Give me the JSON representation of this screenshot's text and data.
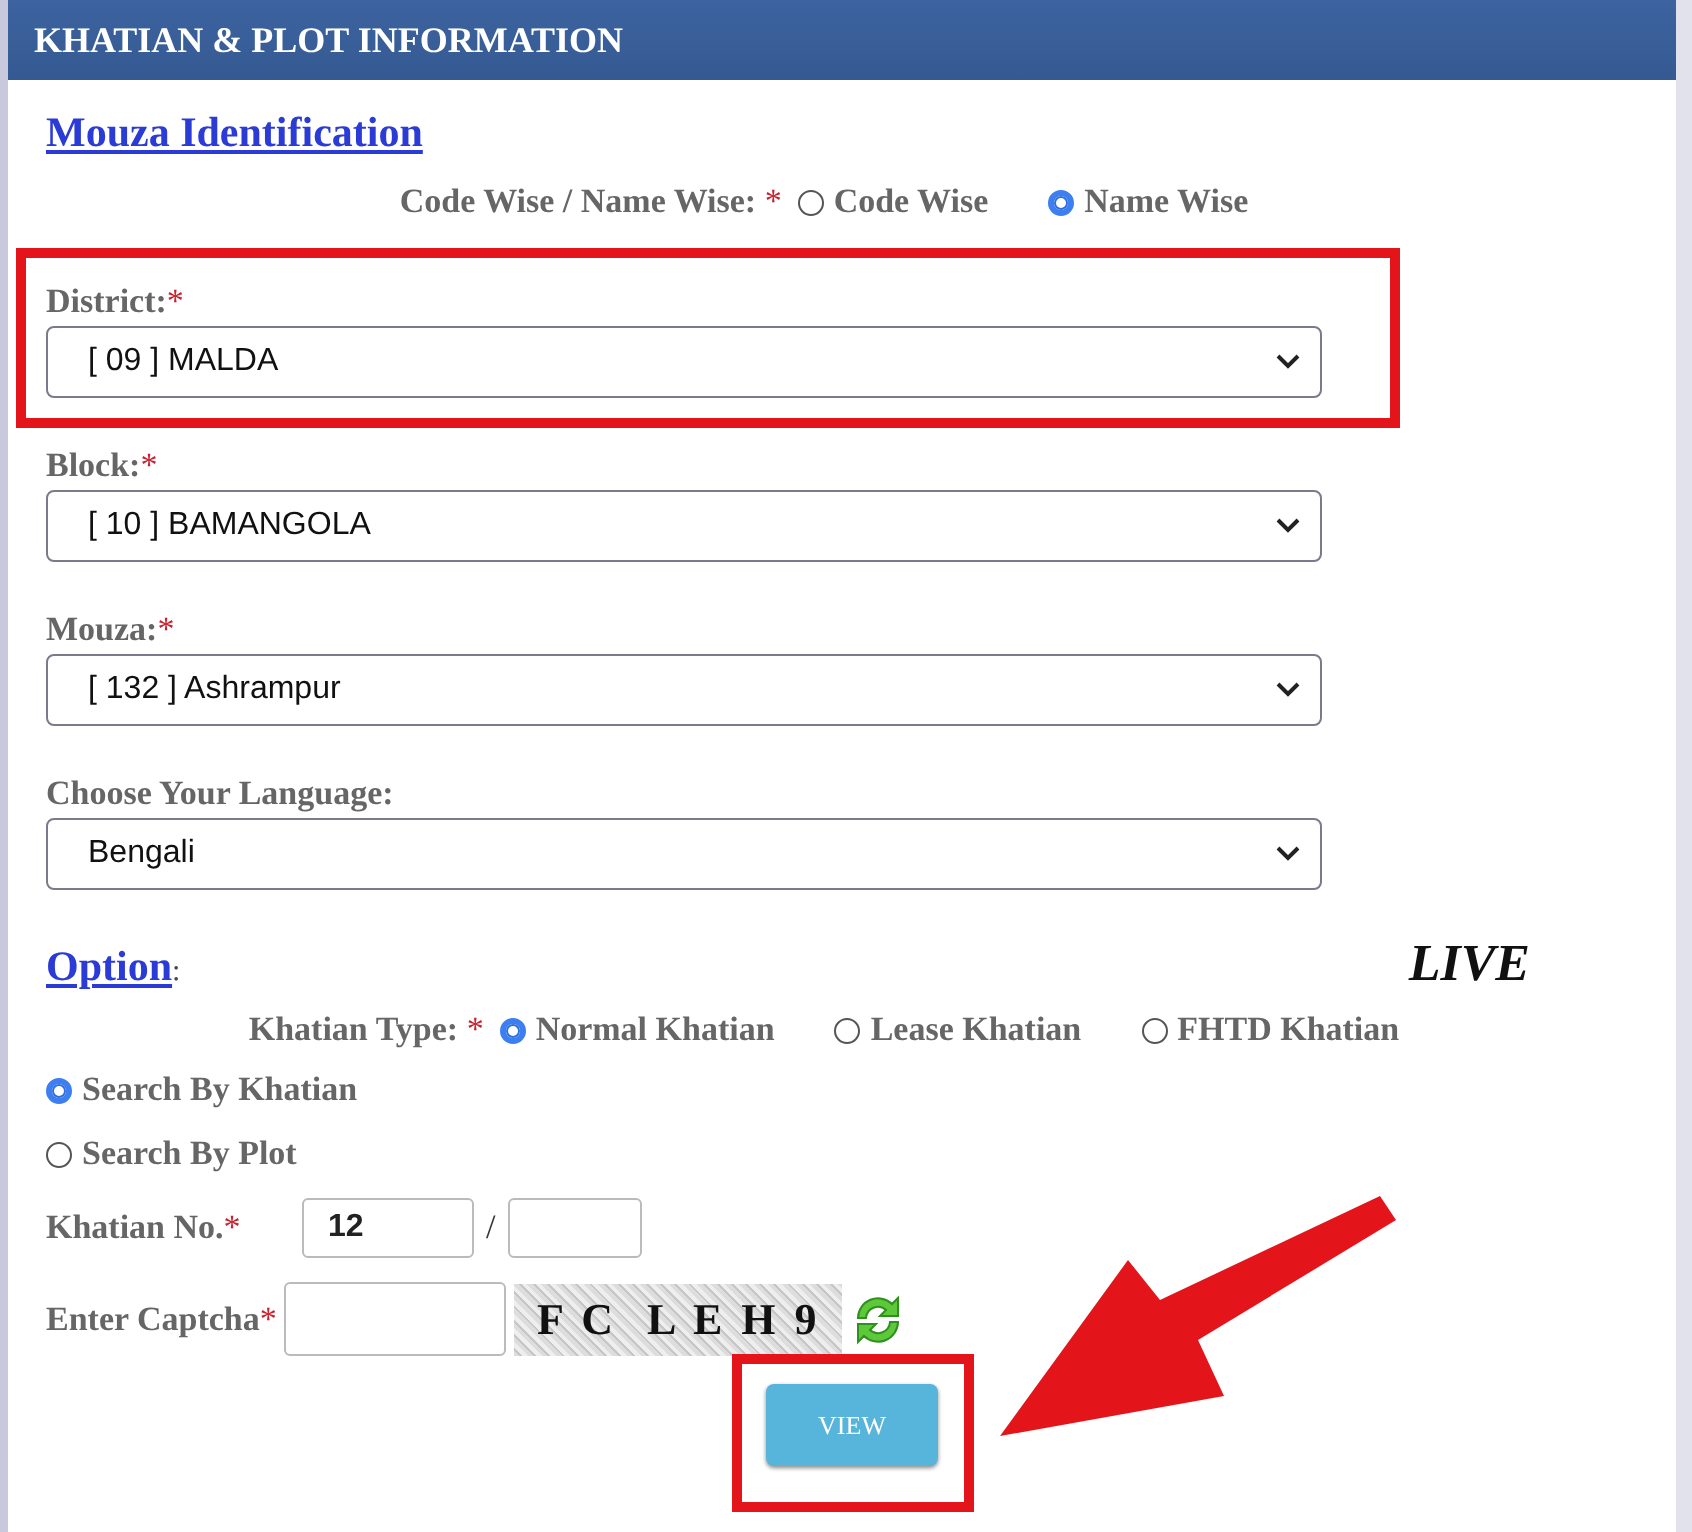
{
  "header": {
    "title": "KHATIAN & PLOT INFORMATION"
  },
  "mouza": {
    "heading": "Mouza Identification",
    "mode_label": "Code Wise / Name Wise:",
    "mode_mark": "*",
    "modes": [
      {
        "label": "Code Wise",
        "selected": false
      },
      {
        "label": "Name Wise",
        "selected": true
      }
    ],
    "fields": [
      {
        "label": "District:",
        "mark": "*",
        "value": "[ 09 ] MALDA",
        "highlighted": true
      },
      {
        "label": "Block:",
        "mark": "*",
        "value": "[ 10 ] BAMANGOLA",
        "highlighted": false
      },
      {
        "label": "Mouza:",
        "mark": "*",
        "value": "[ 132 ] Ashrampur",
        "highlighted": false
      },
      {
        "label": "Choose Your Language:",
        "value": "Bengali",
        "highlighted": false
      }
    ]
  },
  "option": {
    "heading": "Option",
    "colon": ":",
    "live": "LIVE",
    "type_label": "Khatian Type:",
    "type_mark": "*",
    "types": [
      {
        "label": "Normal Khatian",
        "selected": true
      },
      {
        "label": "Lease Khatian",
        "selected": false
      },
      {
        "label": "FHTD Khatian",
        "selected": false
      }
    ],
    "search_by": [
      {
        "label": "Search By Khatian",
        "selected": true
      },
      {
        "label": "Search By Plot",
        "selected": false
      }
    ],
    "khatian_no": {
      "label": "Khatian No.",
      "mark": "*",
      "value": "12",
      "separator": "/"
    },
    "captcha": {
      "label": "Enter Captcha",
      "mark": "*",
      "code": "F C  L E H 9"
    },
    "view_button": {
      "label": "VIEW",
      "highlighted": true
    }
  }
}
